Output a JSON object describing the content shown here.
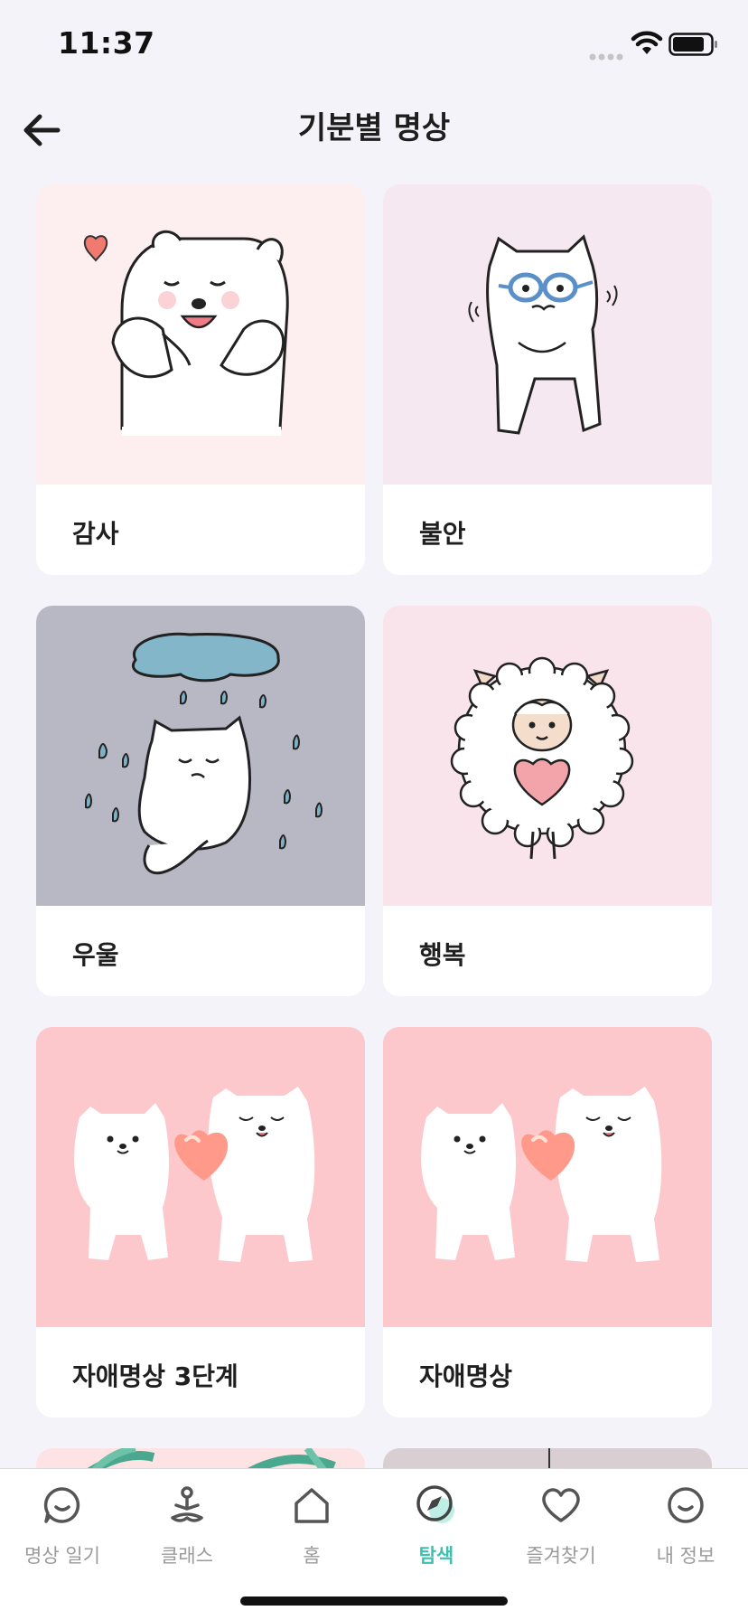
{
  "status_bar": {
    "time": "11:37"
  },
  "header": {
    "title": "기분별 명상"
  },
  "cards": [
    {
      "label": "감사",
      "bg": "#fdeef0"
    },
    {
      "label": "불안",
      "bg": "#f6e8f0"
    },
    {
      "label": "우울",
      "bg": "#b8b7c4"
    },
    {
      "label": "행복",
      "bg": "#f9e4ec"
    },
    {
      "label": "자애명상 3단계",
      "bg": "#fcc8cb"
    },
    {
      "label": "자애명상",
      "bg": "#fcc8cb"
    }
  ],
  "tab_bar": {
    "items": [
      {
        "label": "명상 일기",
        "icon": "chat-smile-icon"
      },
      {
        "label": "클래스",
        "icon": "meditation-person-icon"
      },
      {
        "label": "홈",
        "icon": "home-icon"
      },
      {
        "label": "탐색",
        "icon": "compass-icon",
        "active": true
      },
      {
        "label": "즐겨찾기",
        "icon": "heart-icon"
      },
      {
        "label": "내 정보",
        "icon": "smile-profile-icon"
      }
    ],
    "active_color": "#3cc1b0",
    "inactive_color": "#9a9a9a"
  }
}
